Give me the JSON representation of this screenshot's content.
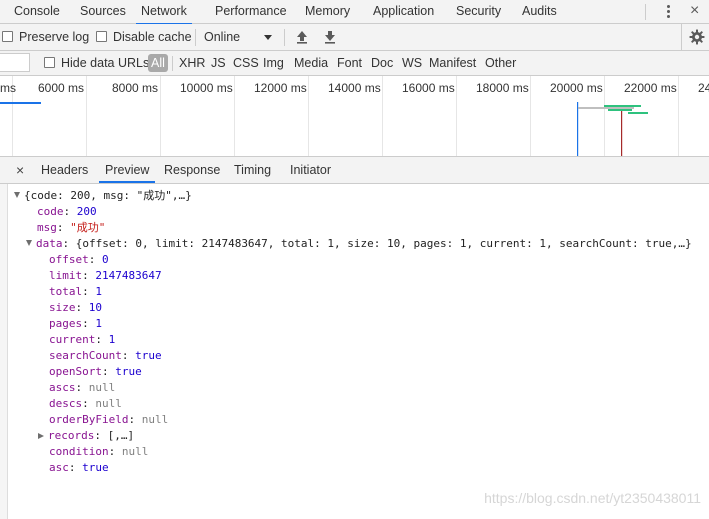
{
  "devtools": {
    "tabs": [
      "Console",
      "Sources",
      "Network",
      "Performance",
      "Memory",
      "Application",
      "Security",
      "Audits"
    ],
    "active_tab": "Network"
  },
  "toolbar": {
    "preserve_log": "Preserve log",
    "disable_cache": "Disable cache",
    "throttling": "Online"
  },
  "filter": {
    "hide_data_urls": "Hide data URLs",
    "types": [
      "All",
      "XHR",
      "JS",
      "CSS",
      "Img",
      "Media",
      "Font",
      "Doc",
      "WS",
      "Manifest",
      "Other"
    ],
    "active_type": "All"
  },
  "overview": {
    "first_label": "ms",
    "tick_labels": [
      "6000 ms",
      "8000 ms",
      "10000 ms",
      "12000 ms",
      "14000 ms",
      "16000 ms",
      "18000 ms",
      "20000 ms",
      "22000 ms",
      "24"
    ],
    "colors": {
      "dom_content_loaded": "#1a73e8",
      "load": "#a52a2a",
      "request": "#2ec27e"
    }
  },
  "detail": {
    "close": "×",
    "tabs": [
      "Headers",
      "Preview",
      "Response",
      "Timing",
      "Initiator"
    ],
    "active_tab": "Preview"
  },
  "preview": {
    "root_summary": "{code: 200, msg: \"成功\",…}",
    "code_key": "code",
    "code_val": "200",
    "msg_key": "msg",
    "msg_val": "\"成功\"",
    "data_key": "data",
    "data_summary": "{offset: 0, limit: 2147483647, total: 1, size: 10, pages: 1, current: 1, searchCount: true,…}",
    "fields": [
      {
        "key": "offset",
        "value": "0",
        "type": "num"
      },
      {
        "key": "limit",
        "value": "2147483647",
        "type": "num"
      },
      {
        "key": "total",
        "value": "1",
        "type": "num"
      },
      {
        "key": "size",
        "value": "10",
        "type": "num"
      },
      {
        "key": "pages",
        "value": "1",
        "type": "num"
      },
      {
        "key": "current",
        "value": "1",
        "type": "num"
      },
      {
        "key": "searchCount",
        "value": "true",
        "type": "num"
      },
      {
        "key": "openSort",
        "value": "true",
        "type": "num"
      },
      {
        "key": "ascs",
        "value": "null",
        "type": "nul"
      },
      {
        "key": "descs",
        "value": "null",
        "type": "nul"
      },
      {
        "key": "orderByField",
        "value": "null",
        "type": "nul"
      }
    ],
    "records_key": "records",
    "records_summary": "[,…]",
    "tail_fields": [
      {
        "key": "condition",
        "value": "null",
        "type": "nul"
      },
      {
        "key": "asc",
        "value": "true",
        "type": "num"
      }
    ]
  },
  "watermark": "https://blog.csdn.net/yt2350438011"
}
